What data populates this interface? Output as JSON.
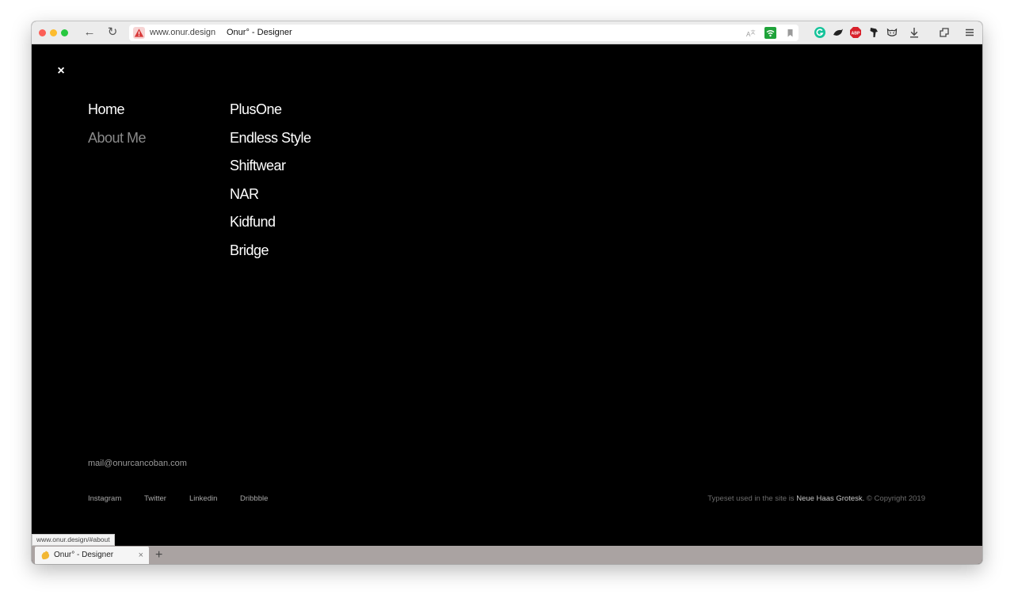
{
  "browser": {
    "url": "www.onur.design",
    "page_title": "Onur° - Designer",
    "status_url": "www.onur.design/#about",
    "tab": {
      "title": "Onur° - Designer",
      "close": "×"
    },
    "new_tab": "+",
    "nav": {
      "back": "←",
      "reload": "↻"
    }
  },
  "page": {
    "close": "×",
    "menu_left": [
      {
        "label": "Home",
        "active": true
      },
      {
        "label": "About Me",
        "active": false
      }
    ],
    "projects": [
      "PlusOne",
      "Endless Style",
      "Shiftwear",
      "NAR",
      "Kidfund",
      "Bridge"
    ],
    "email": "mail@onurcancoban.com",
    "social": [
      "Instagram",
      "Twitter",
      "Linkedin",
      "Dribbble"
    ],
    "credit": {
      "prefix": "Typeset used in the site is ",
      "font_name": "Neue Haas Grotesk.",
      "suffix": " © Copyright 2019"
    }
  },
  "colors": {
    "background": "#000000",
    "text": "#ffffff",
    "muted": "#8a8a8a",
    "tabbar": "#aaa3a2"
  }
}
